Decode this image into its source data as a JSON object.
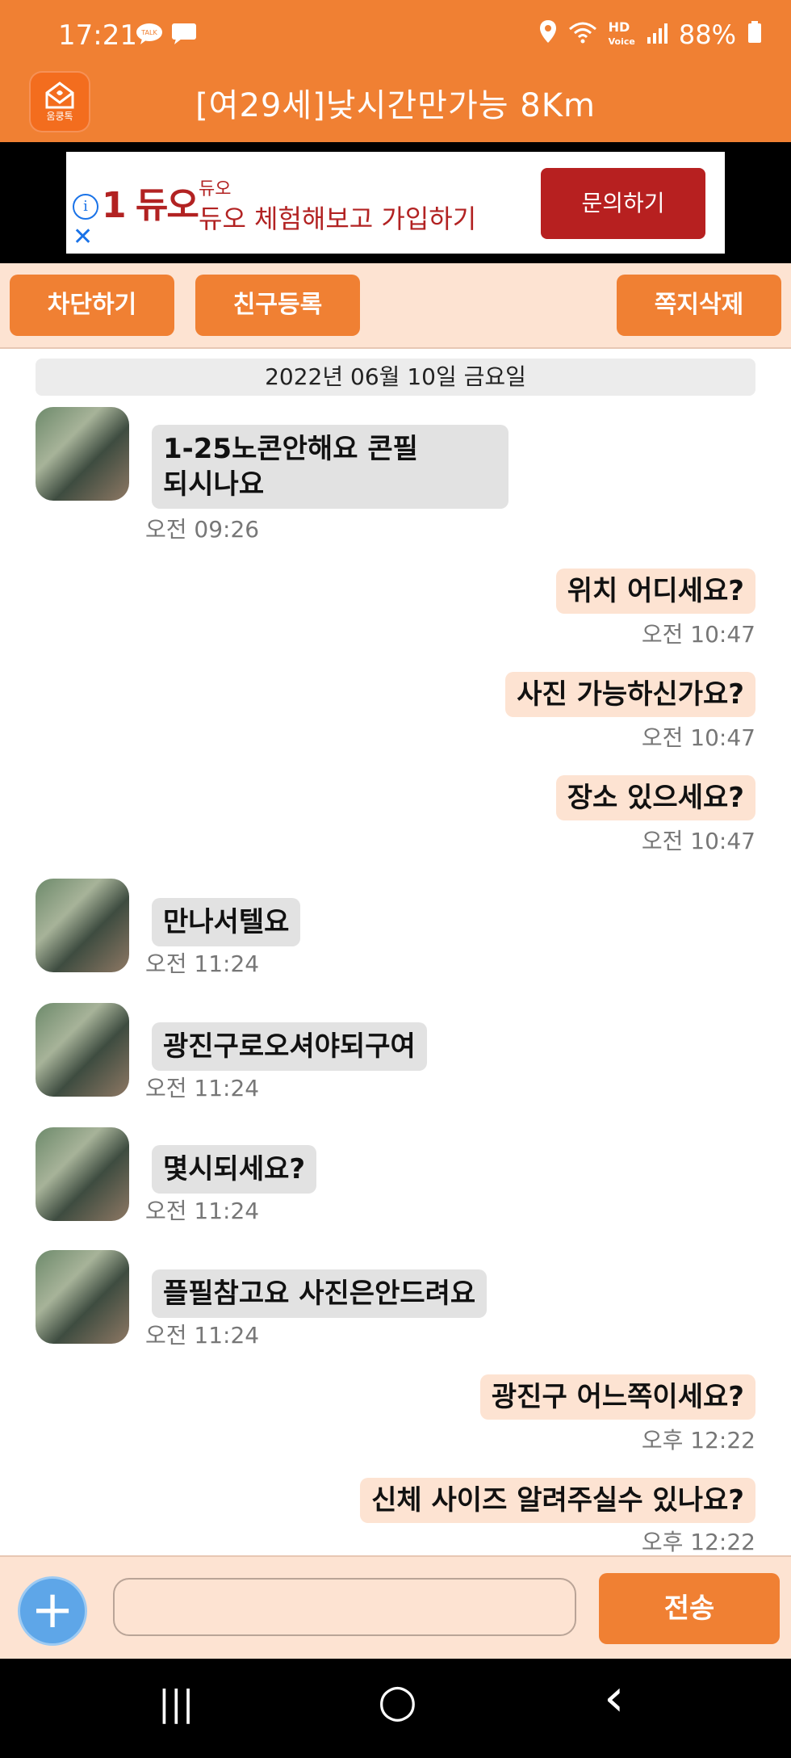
{
  "status": {
    "time": "17:21",
    "battery": "88%",
    "icons_left": [
      "kakaotalk-icon",
      "message-icon"
    ],
    "icons_right": [
      "location-icon",
      "wifi-icon",
      "hd-voice-icon",
      "signal-icon",
      "battery-icon"
    ]
  },
  "app": {
    "logo_text": "움쿵톡",
    "title": "[여29세]낮시간만가능 8Km"
  },
  "ad": {
    "brand": "1 듀오",
    "small_text": "듀오",
    "main_text": "듀오 체험해보고 가입하기",
    "cta": "문의하기"
  },
  "actions": {
    "block": "차단하기",
    "add_friend": "친구등록",
    "delete_note": "쪽지삭제"
  },
  "chat": {
    "date": "2022년 06월 10일 금요일",
    "messages": [
      {
        "dir": "in",
        "text_lines": [
          "1-25노콘안해요 콘필",
          "되시나요"
        ],
        "time": "오전 09:26"
      },
      {
        "dir": "out",
        "text": "위치 어디세요?",
        "time": "오전 10:47"
      },
      {
        "dir": "out",
        "text": "사진 가능하신가요?",
        "time": "오전 10:47"
      },
      {
        "dir": "out",
        "text": "장소 있으세요?",
        "time": "오전 10:47"
      },
      {
        "dir": "in",
        "text": "만나서텔요",
        "time": "오전 11:24"
      },
      {
        "dir": "in",
        "text": "광진구로오셔야되구여",
        "time": "오전 11:24"
      },
      {
        "dir": "in",
        "text": "몇시되세요?",
        "time": "오전 11:24"
      },
      {
        "dir": "in",
        "text": "플필참고요 사진은안드려요",
        "time": "오전 11:24"
      },
      {
        "dir": "out",
        "text": "광진구 어느쪽이세요?",
        "time": "오후 12:22"
      },
      {
        "dir": "out",
        "text": "신체 사이즈 알려주실수 있나요?",
        "time": "오후 12:22"
      }
    ]
  },
  "input": {
    "value": "",
    "placeholder": "",
    "send": "전송"
  },
  "nav": {
    "recent": "|||",
    "home": "○",
    "back": "‹"
  },
  "colors": {
    "accent": "#f08033",
    "bubble_out": "#fde3d2",
    "bubble_in": "#e2e2e2",
    "ad_red": "#b72020"
  }
}
